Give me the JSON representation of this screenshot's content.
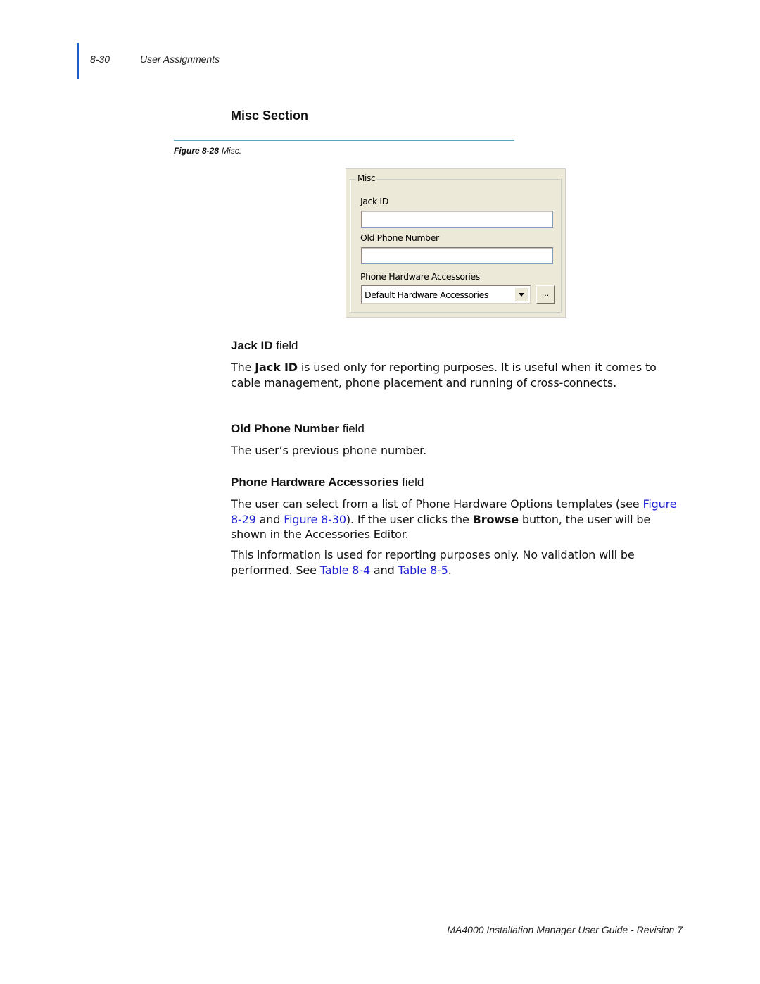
{
  "header": {
    "page_number": "8-30",
    "chapter_title": "User Assignments",
    "accent_color": "#1a5fc8"
  },
  "section": {
    "title": "Misc Section"
  },
  "figure": {
    "label": "Figure 8-28",
    "name": "Misc."
  },
  "dialog": {
    "group_title": "Misc",
    "jack_id_label": "Jack ID",
    "jack_id_value": "",
    "old_phone_label": "Old Phone Number",
    "old_phone_value": "",
    "accessories_label": "Phone Hardware Accessories",
    "accessories_selected": "Default Hardware Accessories",
    "browse_label": "..."
  },
  "jack_id_section": {
    "heading_bold": "Jack ID",
    "heading_rest": " field",
    "text_pre": "The ",
    "text_bold": "Jack ID",
    "text_post": " is used only for reporting purposes. It is useful when it comes to cable management, phone placement and running of cross-connects."
  },
  "old_phone_section": {
    "heading_bold": "Old Phone Number",
    "heading_rest": " field",
    "text": "The user’s previous phone number."
  },
  "accessories_section": {
    "heading_bold": "Phone Hardware Accessories",
    "heading_rest": " field",
    "p1_a": "The user can select from a list of Phone Hardware Options templates (see ",
    "link_fig_829": "Figure 8-29",
    "p1_b": " and ",
    "link_fig_830": "Figure 8-30",
    "p1_c": "). If the user clicks the ",
    "p1_bold": "Browse",
    "p1_d": " button, the user will be shown in the Accessories Editor.",
    "p2_a": "This information is used for reporting purposes only. No validation will be performed. See ",
    "link_table_84": "Table 8-4",
    "p2_b": " and ",
    "link_table_85": "Table 8-5",
    "p2_c": ".",
    "link_color": "#2323d6"
  },
  "footer": {
    "text": "MA4000 Installation Manager User Guide - Revision 7"
  }
}
